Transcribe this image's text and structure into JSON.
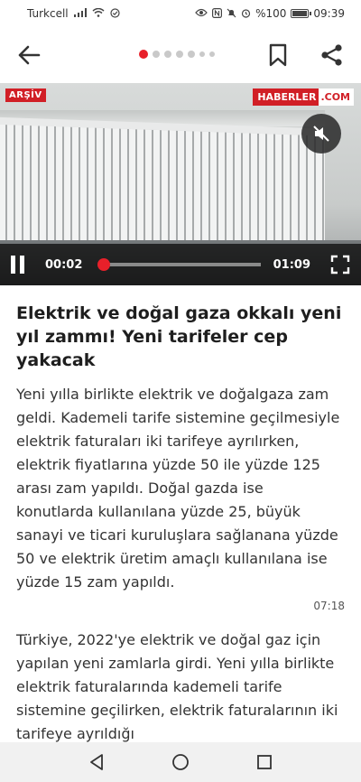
{
  "status_bar": {
    "carrier": "Turkcell",
    "battery_percent": "%100",
    "battery_level": 1.0,
    "time": "09:39"
  },
  "toolbar": {
    "back_icon": "arrow-left-icon",
    "bookmark_icon": "bookmark-icon",
    "share_icon": "share-icon",
    "page_dots_total": 7,
    "page_dots_active": 0
  },
  "video": {
    "archive_badge": "ARŞİV",
    "logo_part1": "HABERLER",
    "logo_part2": ".COM",
    "current_time": "00:02",
    "total_time": "01:09",
    "progress": 0.03,
    "accent_color": "#e8202a"
  },
  "article": {
    "headline": "Elektrik ve doğal gaza okkalı yeni yıl zammı! Yeni tarifeler cep yakacak",
    "lead": "Yeni yılla birlikte elektrik ve doğalgaza zam geldi. Kademeli tarife sistemine geçilmesiyle elektrik faturaları iki tarifeye ayrılırken, elektrik fiyatlarına yüzde 50 ile yüzde 125 arası zam yapıldı. Doğal gazda ise konutlarda kullanılana yüzde 25, büyük sanayi ve ticari kuruluşlara sağlanana yüzde 50 ve elektrik üretim amaçlı kullanılana ise yüzde 15 zam yapıldı.",
    "timestamp": "07:18",
    "body": "Türkiye, 2022'ye elektrik ve doğal gaz için yapılan yeni zamlarla girdi. Yeni yılla birlikte elektrik faturalarında kademeli tarife sistemine geçilirken, elektrik faturalarının iki tarifeye ayrıldığı"
  },
  "nav_bar": {
    "back_icon": "triangle-back-icon",
    "home_icon": "circle-home-icon",
    "recents_icon": "square-recents-icon"
  }
}
